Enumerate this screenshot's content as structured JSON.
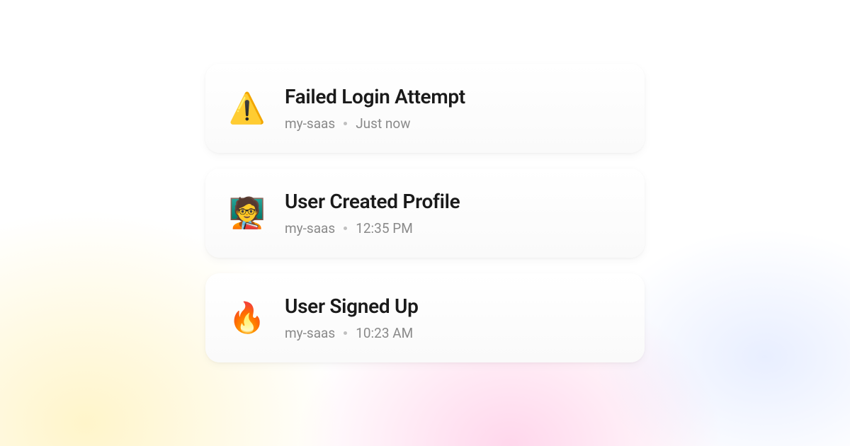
{
  "notifications": [
    {
      "icon": "⚠️",
      "icon_name": "warning-icon",
      "title": "Failed Login Attempt",
      "source": "my-saas",
      "time": "Just now"
    },
    {
      "icon": "🧑‍🏫",
      "icon_name": "teacher-icon",
      "title": "User Created Profile",
      "source": "my-saas",
      "time": "12:35 PM"
    },
    {
      "icon": "🔥",
      "icon_name": "fire-icon",
      "title": "User Signed Up",
      "source": "my-saas",
      "time": "10:23 AM"
    }
  ]
}
